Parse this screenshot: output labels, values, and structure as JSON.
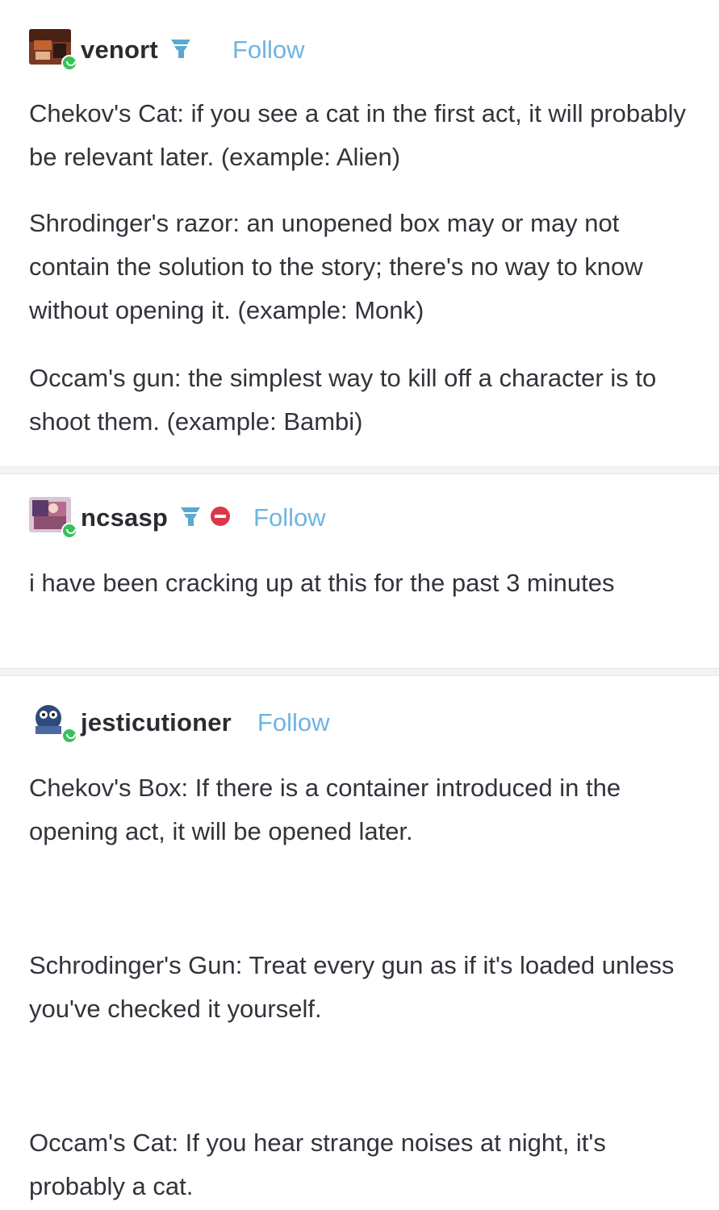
{
  "posts": [
    {
      "username": "venort",
      "follow_label": "Follow",
      "badge_icons": [
        "tumblr-blue-badge-icon"
      ],
      "paragraphs": [
        "Chekov's Cat: if you see a cat in the first act, it will probably be relevant later. (example: Alien)",
        "Shrodinger's razor: an unopened box may or may not contain the solution to the story; there's no way to know without opening it. (example: Monk)",
        "Occam's gun: the simplest way to kill off a character is to shoot them. (example: Bambi)"
      ]
    },
    {
      "username": "ncsasp",
      "follow_label": "Follow",
      "badge_icons": [
        "tumblr-blue-badge-icon",
        "red-stop-badge-icon"
      ],
      "paragraphs": [
        "i have been cracking up at this for the past 3 minutes"
      ]
    },
    {
      "username": "jesticutioner",
      "follow_label": "Follow",
      "badge_icons": [],
      "paragraphs": [
        "Chekov's Box: If there is a container introduced in the opening act, it will be opened later.",
        "Schrodinger's Gun: Treat every gun as if it's loaded unless you've checked it yourself.",
        "Occam's Cat: If you hear strange noises at night, it's probably a cat."
      ]
    }
  ],
  "colors": {
    "follow": "#6fb4e3",
    "online": "#35c25a",
    "text": "#33333b",
    "divider": "#f3f3f5"
  }
}
